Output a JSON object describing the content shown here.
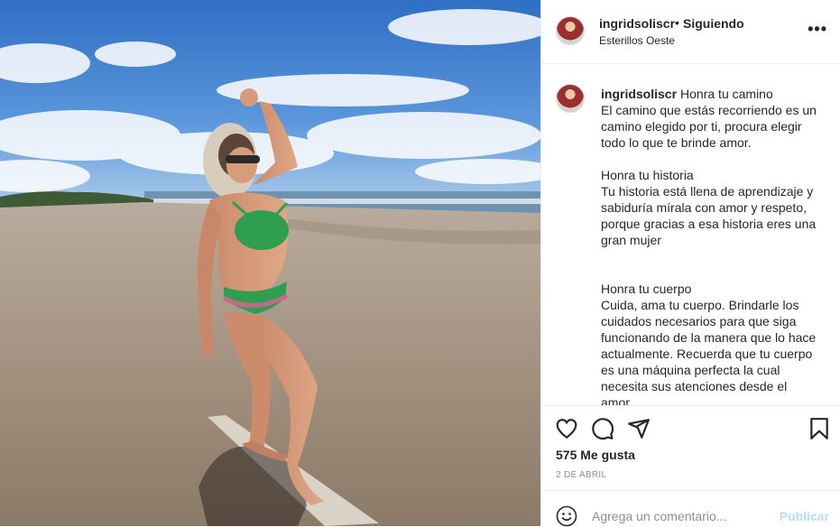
{
  "post": {
    "username": "ingridsoliscr",
    "separator": "•",
    "follow_status": "Siguiendo",
    "location": "Esterillos Oeste",
    "more_label": "•••",
    "caption": {
      "p1_title": "Honra tu camino",
      "p1_body": "El camino que estás recorriendo es un camino elegido por ti, procura elegir todo lo que te brinde amor.",
      "p2_title": "Honra tu historia",
      "p2_body": "Tu historia está llena de aprendizaje y sabiduría míralа con amor y respeto, porque gracias a esa historia eres una gran mujer",
      "p3_title": "Honra tu cuerpo",
      "p3_body": "Cuida, ama tu cuerpo. Brindarle los cuidados necesarios para que siga funcionando de la manera que lo hace actualmente. Recuerda que tu cuerpo es una máquina perfecta la cual necesita sus atenciones desde el amor."
    },
    "likes": "575 Me gusta",
    "date": "2 DE ABRIL",
    "comment_placeholder": "Agrega un comentario...",
    "publish_label": "Publicar"
  },
  "icons": {
    "like": "heart-icon",
    "comment": "comment-icon",
    "share": "send-icon",
    "save": "bookmark-icon",
    "emoji": "smiley-icon",
    "more": "more-options-icon"
  },
  "colors": {
    "text": "#262626",
    "secondary": "#8e8e8e",
    "publish_disabled": "#b2dffc",
    "border": "#efefef"
  }
}
